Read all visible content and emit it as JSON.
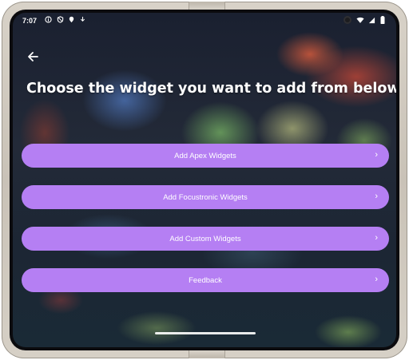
{
  "status_bar": {
    "time": "7:07",
    "left_icons": [
      "info-icon",
      "shield-icon",
      "location-icon",
      "download-icon"
    ],
    "right_icons": [
      "wifi-icon",
      "signal-icon",
      "battery-icon"
    ]
  },
  "header": {
    "title": "Choose the widget you want to add from below."
  },
  "menu": {
    "items": [
      {
        "label": "Add Apex Widgets"
      },
      {
        "label": "Add Focustronic Widgets"
      },
      {
        "label": "Add Custom Widgets"
      },
      {
        "label": "Feedback"
      }
    ],
    "chevron": "›"
  },
  "colors": {
    "button_bg": "#b57ff3",
    "text": "#ffffff"
  }
}
